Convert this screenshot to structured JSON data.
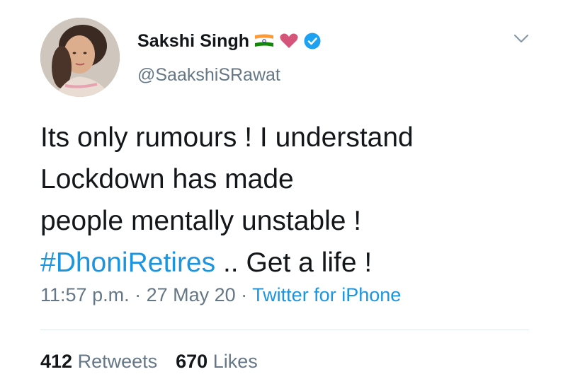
{
  "tweet": {
    "author_name": "Sakshi Singh",
    "author_handle": "@SaakshiSRawat",
    "name_emojis": [
      "india-flag-icon",
      "pink-heart-icon"
    ],
    "verified": true,
    "text_lines": [
      "Its only rumours ! I understand",
      "Lockdown has made",
      "people mentally unstable !"
    ],
    "hashtag": "#DhoniRetires",
    "text_after_hashtag": " .. Get a life !",
    "time": "11:57 p.m.",
    "separator": " · ",
    "date": "27 May 20",
    "source": "Twitter for iPhone",
    "stats": {
      "retweets_count": "412",
      "retweets_label": "Retweets",
      "likes_count": "670",
      "likes_label": "Likes"
    }
  },
  "colors": {
    "text": "#14171a",
    "secondary": "#657786",
    "link": "#1b95e0",
    "verified": "#1da1f2",
    "heart": "#d4547a",
    "divider": "#e1e8ed"
  }
}
